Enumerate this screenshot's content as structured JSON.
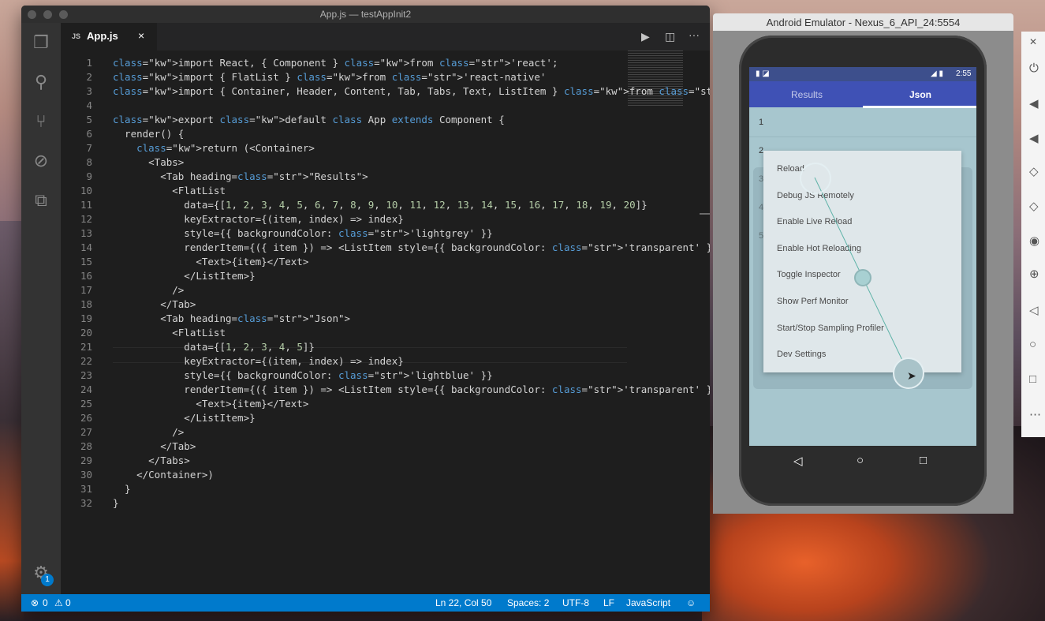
{
  "vscode": {
    "title": "App.js — testAppInit2",
    "tab": {
      "type": "JS",
      "name": "App.js",
      "close": "×"
    },
    "toolbar": {
      "run": "▶",
      "split": "◫",
      "more": "···"
    },
    "status": {
      "errors": "0",
      "warnings": "0",
      "position": "Ln 22, Col 50",
      "spaces": "Spaces: 2",
      "encoding": "UTF-8",
      "eol": "LF",
      "language": "JavaScript"
    },
    "badge": "1",
    "lines": [
      {
        "n": "1"
      },
      {
        "n": "2"
      },
      {
        "n": "3"
      },
      {
        "n": "4"
      },
      {
        "n": "5"
      },
      {
        "n": "6"
      },
      {
        "n": "7"
      },
      {
        "n": "8"
      },
      {
        "n": "9"
      },
      {
        "n": "10"
      },
      {
        "n": "11"
      },
      {
        "n": "12"
      },
      {
        "n": "13"
      },
      {
        "n": "14"
      },
      {
        "n": "15"
      },
      {
        "n": "16"
      },
      {
        "n": "17"
      },
      {
        "n": "18"
      },
      {
        "n": "19"
      },
      {
        "n": "20"
      },
      {
        "n": "21"
      },
      {
        "n": "22"
      },
      {
        "n": "23"
      },
      {
        "n": "24"
      },
      {
        "n": "25"
      },
      {
        "n": "26"
      },
      {
        "n": "27"
      },
      {
        "n": "28"
      },
      {
        "n": "29"
      },
      {
        "n": "30"
      },
      {
        "n": "31"
      },
      {
        "n": "32"
      }
    ],
    "code": [
      "import React, { Component } from 'react';",
      "import { FlatList } from 'react-native'",
      "import { Container, Header, Content, Tab, Tabs, Text, ListItem } from 'native-base';",
      "",
      "export default class App extends Component {",
      "  render() {",
      "    return (<Container>",
      "      <Tabs>",
      "        <Tab heading=\"Results\">",
      "          <FlatList",
      "            data={[1, 2, 3, 4, 5, 6, 7, 8, 9, 10, 11, 12, 13, 14, 15, 16, 17, 18, 19, 20]}",
      "            keyExtractor={(item, index) => index}",
      "            style={{ backgroundColor: 'lightgrey' }}",
      "            renderItem={({ item }) => <ListItem style={{ backgroundColor: 'transparent' }}>",
      "              <Text>{item}</Text>",
      "            </ListItem>}",
      "          />",
      "        </Tab>",
      "        <Tab heading=\"Json\">",
      "          <FlatList",
      "            data={[1, 2, 3, 4, 5]}",
      "            keyExtractor={(item, index) => index}",
      "            style={{ backgroundColor: 'lightblue' }}",
      "            renderItem={({ item }) => <ListItem style={{ backgroundColor: 'transparent' }}>",
      "              <Text>{item}</Text>",
      "            </ListItem>}",
      "          />",
      "        </Tab>",
      "      </Tabs>",
      "    </Container>)",
      "  }",
      "}"
    ]
  },
  "emulator": {
    "title": "Android Emulator - Nexus_6_API_24:5554",
    "clock": "2:55",
    "tabs": [
      "Results",
      "Json"
    ],
    "list": [
      "1",
      "2",
      "3",
      "4",
      "5"
    ],
    "menu": [
      "Reload",
      "Debug JS Remotely",
      "Enable Live Reload",
      "Enable Hot Reloading",
      "Toggle Inspector",
      "Show Perf Monitor",
      "Start/Stop Sampling Profiler",
      "Dev Settings"
    ]
  },
  "sidepanel": {
    "close": "✕"
  }
}
